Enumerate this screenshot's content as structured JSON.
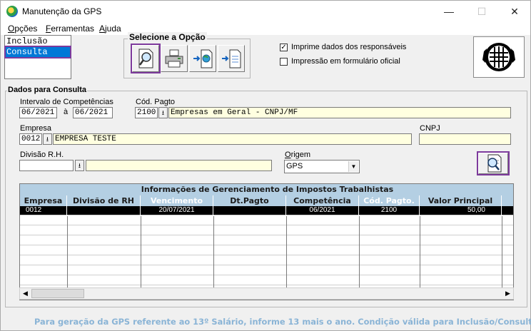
{
  "window": {
    "title": "Manutenção da GPS",
    "minimize": "—",
    "maximize": "☐",
    "close": "✕"
  },
  "menu": {
    "items": [
      {
        "first": "O",
        "rest": "pções"
      },
      {
        "first": "F",
        "rest": "erramentas"
      },
      {
        "first": "A",
        "rest": "juda"
      }
    ]
  },
  "modes": [
    "Inclusão",
    "Consulta"
  ],
  "option_group": {
    "label": "Selecione a Opção",
    "tools": [
      "search-document-icon",
      "printer-icon",
      "export-to-globe-icon",
      "export-to-file-icon"
    ]
  },
  "checkboxes": [
    {
      "label": "Imprime dados dos responsáveis",
      "checked": true
    },
    {
      "label": "Impressão em formulário oficial",
      "checked": false
    }
  ],
  "consulta": {
    "label": "Dados para Consulta",
    "intervalo_label": "Intervalo de Competências",
    "intervalo_from": "06/2021",
    "intervalo_sep": "à",
    "intervalo_to": "06/2021",
    "cod_pagto_label": "Cód. Pagto",
    "cod_pagto_code": "2100",
    "cod_pagto_desc": "Empresas em Geral - CNPJ/MF",
    "empresa_label": "Empresa",
    "empresa_code": "0012",
    "empresa_name": "EMPRESA TESTE",
    "cnpj_label": "CNPJ",
    "cnpj_value": "",
    "divisao_label": "Divisão R.H.",
    "divisao_code": "",
    "divisao_desc": "",
    "origem_label": "Origem",
    "origem_value": "GPS",
    "origem_first": "O",
    "origem_rest": "rigem"
  },
  "grid": {
    "title": "Informações de Gerenciamento de Impostos Trabalhistas",
    "headers": [
      "Empresa",
      "Divisão de RH",
      "Vencimento",
      "Dt.Pagto",
      "Competência",
      "Cód. Pagto.",
      "Valor Principal"
    ],
    "rows": [
      [
        "0012",
        "",
        "20/07/2021",
        "",
        "06/2021",
        "2100",
        "50,00"
      ]
    ]
  },
  "scroll": {
    "left": "◀",
    "right": "▶"
  },
  "status": "Para geração da GPS referente ao 13º Salário, informe 13 mais o ano. Condição válida para Inclusão/Consulta."
}
